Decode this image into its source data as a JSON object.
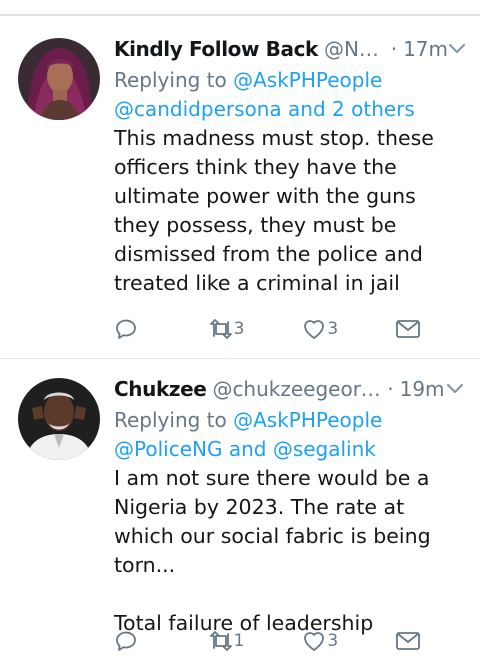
{
  "tweets": [
    {
      "name": "Kindly Follow Back",
      "handle": "@Naij...",
      "separator": "·",
      "time": "17m",
      "replying_prefix": "Replying to ",
      "replying_user": "@AskPHPeople",
      "replying_rest": "@candidpersona and 2 others",
      "text": "This madness must stop. these officers think they have the ultimate power with the guns they possess, they must be dismissed from the police and treated like a criminal in jail",
      "retweets": "3",
      "likes": "3",
      "icons": [
        "avatar-portrait",
        "chevron-down-icon",
        "reply-icon",
        "retweet-icon",
        "like-icon",
        "dm-icon"
      ]
    },
    {
      "name": "Chukzee",
      "handle": "@chukzeegeorge",
      "separator": "·",
      "time": "19m",
      "replying_prefix": "Replying to ",
      "replying_user": "@AskPHPeople",
      "replying_line2_user1": "@PoliceNG",
      "replying_line2_and": " and ",
      "replying_line2_user2": "@segalink",
      "text": "I am not sure there would be a Nigeria by 2023. The rate at which our social fabric is being torn...\n\nTotal failure of leadership",
      "retweets": "1",
      "likes": "3",
      "icons": [
        "avatar-portrait",
        "chevron-down-icon",
        "reply-icon",
        "retweet-icon",
        "like-icon",
        "dm-icon"
      ]
    }
  ],
  "colors": {
    "link": "#1da1f2",
    "muted": "#657786",
    "divider": "#e1e8ed"
  }
}
